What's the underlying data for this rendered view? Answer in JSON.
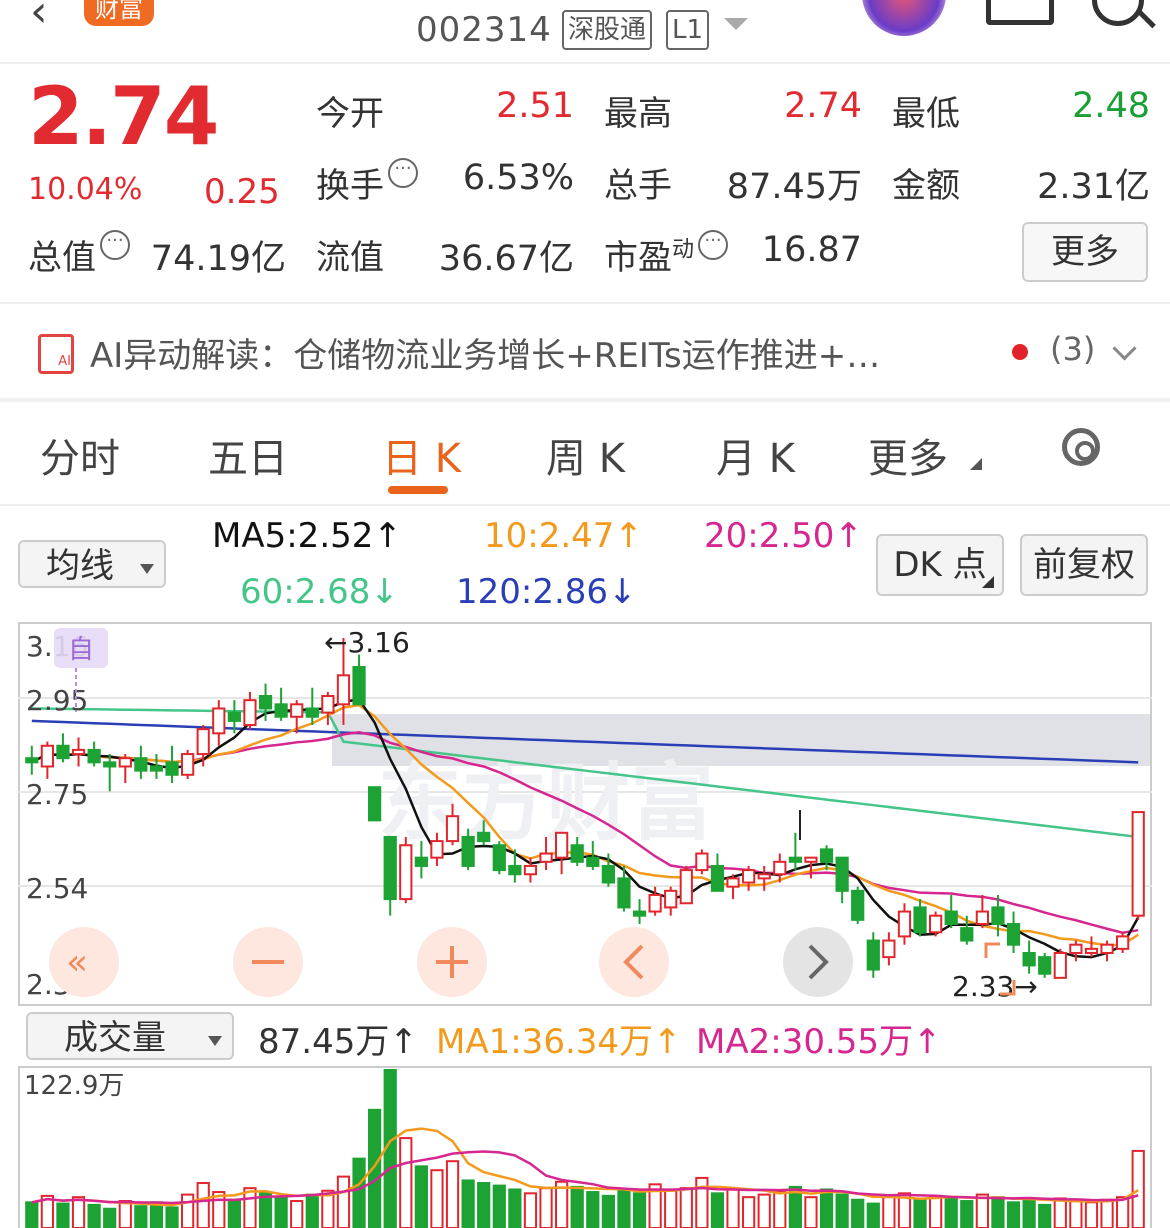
{
  "header": {
    "brand": "财富",
    "code": "002314",
    "tag1": "深股通",
    "tag2": "L1"
  },
  "quote": {
    "price": "2.74",
    "change_pct": "10.04%",
    "change": "0.25",
    "stats": [
      {
        "label": "今开",
        "value": "2.51",
        "color": "#e22b30"
      },
      {
        "label": "最高",
        "value": "2.74",
        "color": "#e22b30"
      },
      {
        "label": "最低",
        "value": "2.48",
        "color": "#1a9e35"
      },
      {
        "label": "换手",
        "value": "6.53%",
        "color": "#333333"
      },
      {
        "label": "总手",
        "value": "87.45万",
        "color": "#333333"
      },
      {
        "label": "金额",
        "value": "2.31亿",
        "color": "#333333"
      },
      {
        "label": "总值",
        "value": "74.19亿",
        "color": "#333333"
      },
      {
        "label": "流值",
        "value": "36.67亿",
        "color": "#333333"
      },
      {
        "label": "市盈",
        "sup": "动",
        "value": "16.87",
        "color": "#333333"
      }
    ],
    "more_label": "更多"
  },
  "ai": {
    "text": "AI异动解读：仓储物流业务增长+REITs运作推进+…",
    "count": "(3)"
  },
  "tabs": [
    "分时",
    "五日",
    "日 K",
    "周 K",
    "月 K",
    "更多"
  ],
  "active_tab": "日 K",
  "indicators": {
    "ma_select": "均线",
    "ma5": "MA5:2.52",
    "ma10": "10:2.47",
    "ma20": "20:2.50",
    "ma60": "60:2.68",
    "ma120": "120:2.86",
    "up_arrow": "↑",
    "down_arrow": "↓",
    "dk_label": "DK 点",
    "fq_label": "前复权",
    "colors": {
      "ma5": "#111111",
      "ma10": "#f39a1c",
      "ma20": "#d6268f",
      "ma60": "#45c58a",
      "ma120": "#2a3fb5"
    }
  },
  "kline": {
    "y_ticks": [
      "3.16",
      "2.95",
      "2.75",
      "2.54",
      "2.33"
    ],
    "max_label": "3.16",
    "min_label": "2.33",
    "marker_self": "自",
    "watermark": "东方财富"
  },
  "volume": {
    "select": "成交量",
    "value": "87.45万",
    "ma1": "MA1:36.34万",
    "ma2": "MA2:30.55万",
    "top_label": "122.9万"
  },
  "chart_data": {
    "type": "candlestick",
    "ylim": [
      2.33,
      3.16
    ],
    "ohlc": [
      [
        2.87,
        2.9,
        2.83,
        2.86
      ],
      [
        2.85,
        2.91,
        2.82,
        2.9
      ],
      [
        2.9,
        2.93,
        2.86,
        2.87
      ],
      [
        2.88,
        2.92,
        2.85,
        2.89
      ],
      [
        2.89,
        2.91,
        2.85,
        2.86
      ],
      [
        2.86,
        2.88,
        2.79,
        2.85
      ],
      [
        2.85,
        2.88,
        2.81,
        2.87
      ],
      [
        2.87,
        2.9,
        2.82,
        2.84
      ],
      [
        2.85,
        2.88,
        2.82,
        2.84
      ],
      [
        2.86,
        2.9,
        2.81,
        2.83
      ],
      [
        2.83,
        2.89,
        2.82,
        2.88
      ],
      [
        2.88,
        2.95,
        2.85,
        2.94
      ],
      [
        2.93,
        3.01,
        2.9,
        2.99
      ],
      [
        2.98,
        3.01,
        2.93,
        2.96
      ],
      [
        2.95,
        3.03,
        2.94,
        3.01
      ],
      [
        3.02,
        3.05,
        2.96,
        2.99
      ],
      [
        3.0,
        3.04,
        2.96,
        2.97
      ],
      [
        2.97,
        3.01,
        2.93,
        3.0
      ],
      [
        2.99,
        3.04,
        2.95,
        2.97
      ],
      [
        2.98,
        3.03,
        2.95,
        3.02
      ],
      [
        3.0,
        3.16,
        2.95,
        3.07
      ],
      [
        3.09,
        3.12,
        3.0,
        3.0
      ],
      [
        2.8,
        2.8,
        2.72,
        2.72
      ],
      [
        2.68,
        2.68,
        2.49,
        2.53
      ],
      [
        2.53,
        2.68,
        2.52,
        2.66
      ],
      [
        2.63,
        2.67,
        2.58,
        2.61
      ],
      [
        2.63,
        2.69,
        2.61,
        2.67
      ],
      [
        2.67,
        2.76,
        2.66,
        2.73
      ],
      [
        2.68,
        2.7,
        2.6,
        2.61
      ],
      [
        2.69,
        2.72,
        2.66,
        2.67
      ],
      [
        2.66,
        2.67,
        2.59,
        2.6
      ],
      [
        2.61,
        2.65,
        2.57,
        2.59
      ],
      [
        2.59,
        2.63,
        2.57,
        2.61
      ],
      [
        2.62,
        2.68,
        2.6,
        2.64
      ],
      [
        2.63,
        2.69,
        2.59,
        2.69
      ],
      [
        2.66,
        2.68,
        2.61,
        2.62
      ],
      [
        2.63,
        2.67,
        2.6,
        2.61
      ],
      [
        2.61,
        2.64,
        2.56,
        2.57
      ],
      [
        2.58,
        2.61,
        2.5,
        2.51
      ],
      [
        2.5,
        2.53,
        2.47,
        2.49
      ],
      [
        2.5,
        2.56,
        2.49,
        2.54
      ],
      [
        2.51,
        2.56,
        2.49,
        2.55
      ],
      [
        2.52,
        2.61,
        2.52,
        2.6
      ],
      [
        2.6,
        2.65,
        2.59,
        2.64
      ],
      [
        2.61,
        2.64,
        2.55,
        2.55
      ],
      [
        2.56,
        2.59,
        2.53,
        2.58
      ],
      [
        2.57,
        2.61,
        2.55,
        2.6
      ],
      [
        2.58,
        2.61,
        2.55,
        2.59
      ],
      [
        2.59,
        2.64,
        2.57,
        2.62
      ],
      [
        2.63,
        2.69,
        2.6,
        2.62
      ],
      [
        2.62,
        2.63,
        2.58,
        2.63
      ],
      [
        2.65,
        2.66,
        2.6,
        2.62
      ],
      [
        2.63,
        2.63,
        2.52,
        2.55
      ],
      [
        2.55,
        2.56,
        2.47,
        2.48
      ],
      [
        2.43,
        2.45,
        2.34,
        2.36
      ],
      [
        2.39,
        2.45,
        2.37,
        2.43
      ],
      [
        2.44,
        2.52,
        2.42,
        2.5
      ],
      [
        2.51,
        2.53,
        2.44,
        2.45
      ],
      [
        2.45,
        2.5,
        2.44,
        2.49
      ],
      [
        2.5,
        2.54,
        2.46,
        2.47
      ],
      [
        2.46,
        2.49,
        2.42,
        2.43
      ],
      [
        2.47,
        2.54,
        2.46,
        2.5
      ],
      [
        2.51,
        2.54,
        2.44,
        2.47
      ],
      [
        2.47,
        2.5,
        2.4,
        2.42
      ],
      [
        2.4,
        2.43,
        2.35,
        2.37
      ],
      [
        2.39,
        2.4,
        2.34,
        2.35
      ],
      [
        2.34,
        2.41,
        2.34,
        2.4
      ],
      [
        2.4,
        2.43,
        2.38,
        2.42
      ],
      [
        2.4,
        2.44,
        2.39,
        2.41
      ],
      [
        2.4,
        2.43,
        2.38,
        2.42
      ],
      [
        2.41,
        2.45,
        2.4,
        2.44
      ],
      [
        2.49,
        2.74,
        2.48,
        2.74
      ]
    ],
    "volume": [
      20,
      25,
      19,
      24,
      18,
      15,
      21,
      17,
      20,
      16,
      26,
      35,
      28,
      22,
      31,
      27,
      24,
      21,
      26,
      29,
      40,
      54,
      92,
      123,
      70,
      48,
      45,
      52,
      37,
      35,
      33,
      30,
      27,
      31,
      36,
      32,
      28,
      25,
      30,
      27,
      34,
      29,
      31,
      39,
      27,
      30,
      24,
      26,
      28,
      32,
      24,
      30,
      26,
      22,
      19,
      24,
      27,
      22,
      25,
      23,
      21,
      26,
      24,
      20,
      22,
      18,
      23,
      21,
      20,
      22,
      24,
      60
    ]
  }
}
